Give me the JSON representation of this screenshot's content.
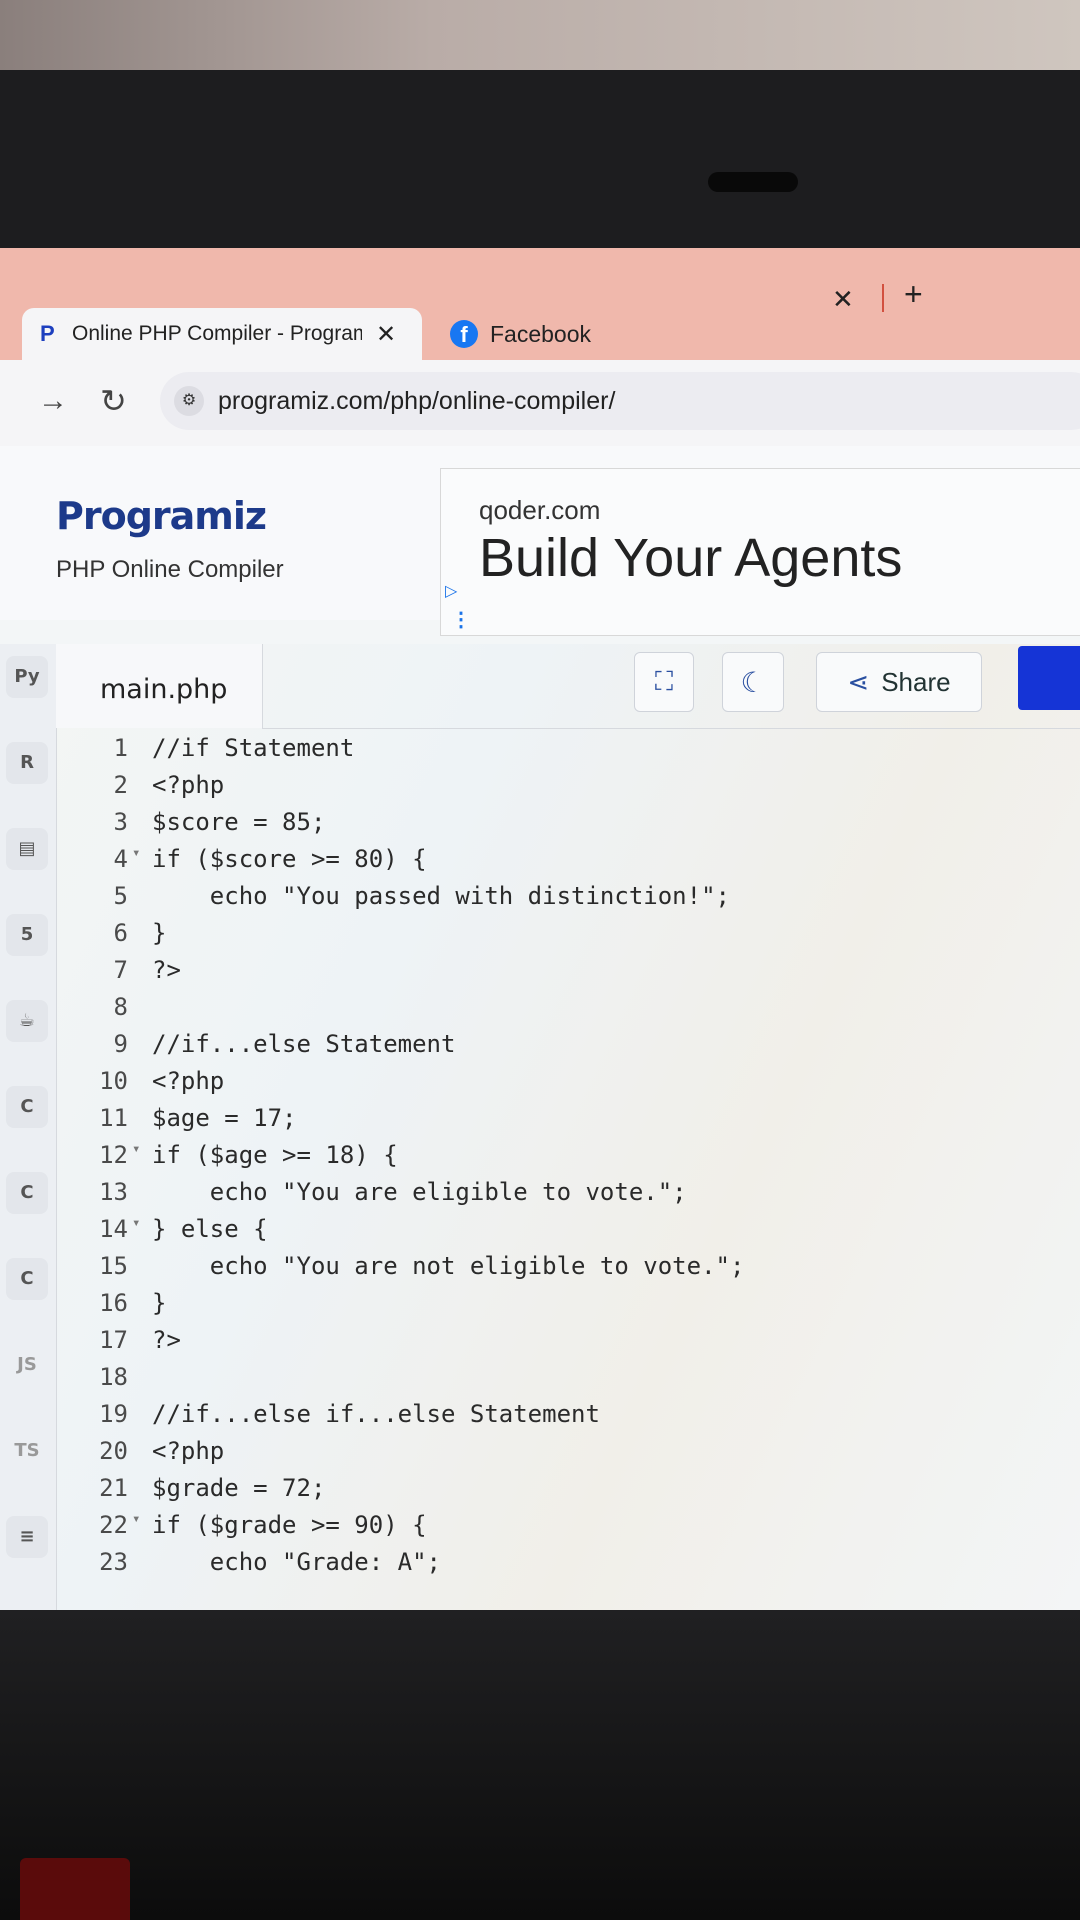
{
  "browser": {
    "tabs": [
      {
        "label": "Online PHP Compiler - Program",
        "icon": "programiz-icon",
        "active": true
      },
      {
        "label": "Facebook",
        "icon": "facebook-icon",
        "active": false
      }
    ],
    "address": "programiz.com/php/online-compiler/"
  },
  "header": {
    "logo": "Programiz",
    "subtitle": "PHP Online Compiler"
  },
  "ad": {
    "domain": "qoder.com",
    "headline": "Build Your Agents"
  },
  "sidebar": {
    "languages": [
      "python",
      "r",
      "sql",
      "html",
      "java",
      "c",
      "cpp",
      "csharp",
      "js",
      "ts",
      "more"
    ],
    "js_label": "JS",
    "ts_label": "TS"
  },
  "editor": {
    "filename": "main.php",
    "share_label": "Share",
    "lines": [
      {
        "n": "1",
        "fold": "",
        "text": "//if Statement"
      },
      {
        "n": "2",
        "fold": "",
        "text": "<?php"
      },
      {
        "n": "3",
        "fold": "",
        "text": "$score = 85;"
      },
      {
        "n": "4",
        "fold": "▾",
        "text": "if ($score >= 80) {"
      },
      {
        "n": "5",
        "fold": "",
        "text": "    echo \"You passed with distinction!\";"
      },
      {
        "n": "6",
        "fold": "",
        "text": "}"
      },
      {
        "n": "7",
        "fold": "",
        "text": "?>"
      },
      {
        "n": "8",
        "fold": "",
        "text": ""
      },
      {
        "n": "9",
        "fold": "",
        "text": "//if...else Statement"
      },
      {
        "n": "10",
        "fold": "",
        "text": "<?php"
      },
      {
        "n": "11",
        "fold": "",
        "text": "$age = 17;"
      },
      {
        "n": "12",
        "fold": "▾",
        "text": "if ($age >= 18) {"
      },
      {
        "n": "13",
        "fold": "",
        "text": "    echo \"You are eligible to vote.\";"
      },
      {
        "n": "14",
        "fold": "▾",
        "text": "} else {"
      },
      {
        "n": "15",
        "fold": "",
        "text": "    echo \"You are not eligible to vote.\";"
      },
      {
        "n": "16",
        "fold": "",
        "text": "}"
      },
      {
        "n": "17",
        "fold": "",
        "text": "?>"
      },
      {
        "n": "18",
        "fold": "",
        "text": ""
      },
      {
        "n": "19",
        "fold": "",
        "text": "//if...else if...else Statement"
      },
      {
        "n": "20",
        "fold": "",
        "text": "<?php"
      },
      {
        "n": "21",
        "fold": "",
        "text": "$grade = 72;"
      },
      {
        "n": "22",
        "fold": "▾",
        "text": "if ($grade >= 90) {"
      },
      {
        "n": "23",
        "fold": "",
        "text": "    echo \"Grade: A\";"
      }
    ]
  }
}
